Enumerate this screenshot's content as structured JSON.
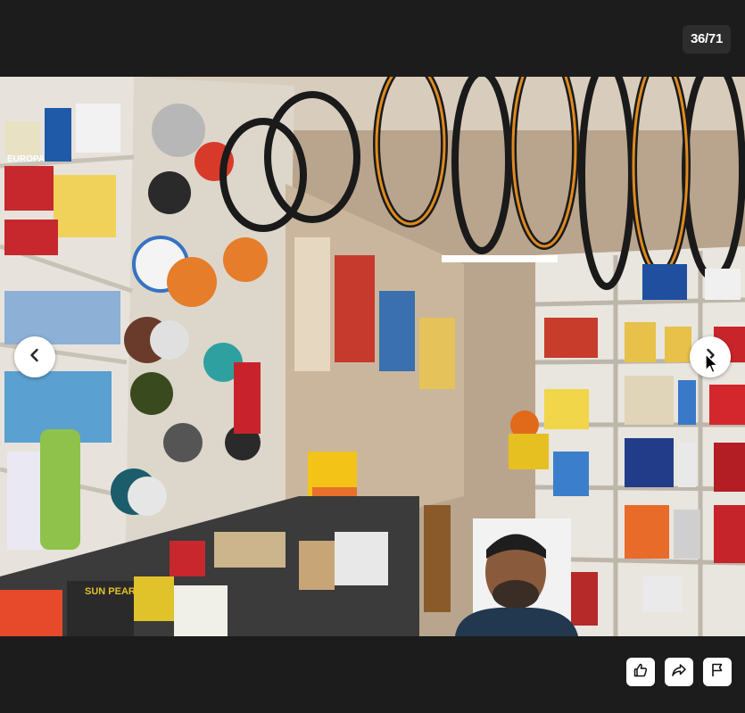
{
  "viewer": {
    "counter": "36/71"
  },
  "photo": {
    "alt_visible_labels": {
      "box_brand_left": "EUROPA",
      "bin_label": "SUN PEARL"
    }
  },
  "navigation": {
    "previous_icon": "chevron-left-icon",
    "next_icon": "chevron-right-icon"
  },
  "actions": {
    "like_icon": "thumbs-up-icon",
    "share_icon": "share-icon",
    "report_icon": "flag-icon"
  },
  "colors": {
    "background": "#1c1c1c",
    "counter_bg": "#2d2d2d",
    "button_bg": "#ffffff"
  }
}
